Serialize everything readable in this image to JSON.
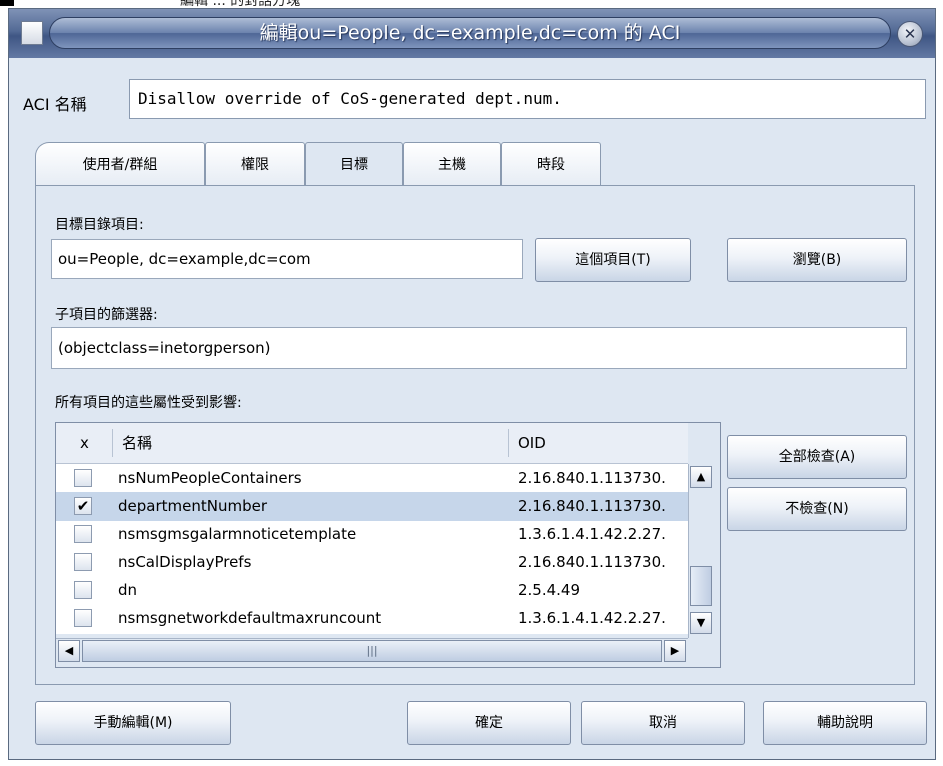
{
  "caption": {
    "text": "編輯 ... 的對話方塊"
  },
  "window": {
    "title": "編輯ou=People, dc=example,dc=com 的 ACI",
    "icon": "document-icon",
    "close_icon": "close-icon"
  },
  "aci": {
    "label": "ACI 名稱",
    "value": "Disallow override of CoS-generated dept.num."
  },
  "tabs": [
    {
      "label": "使用者/群組",
      "active": false
    },
    {
      "label": "權限",
      "active": false
    },
    {
      "label": "目標",
      "active": true
    },
    {
      "label": "主機",
      "active": false
    },
    {
      "label": "時段",
      "active": false
    }
  ],
  "target": {
    "dir_label": "目標目錄項目:",
    "dir_value": "ou=People, dc=example,dc=com",
    "this_entry_button": "這個項目(T)",
    "browse_button": "瀏覽(B)",
    "filter_label": "子項目的篩選器:",
    "filter_value": "(objectclass=inetorgperson)",
    "attrs_label": "所有項目的這些屬性受到影響:"
  },
  "table": {
    "columns": [
      "x",
      "名稱",
      "OID"
    ],
    "rows": [
      {
        "checked": false,
        "name": "nsNumPeopleContainers",
        "oid": "2.16.840.1.113730.",
        "selected": false
      },
      {
        "checked": true,
        "name": "departmentNumber",
        "oid": "2.16.840.1.113730.",
        "selected": true
      },
      {
        "checked": false,
        "name": "nsmsgmsgalarmnoticetemplate",
        "oid": "1.3.6.1.4.1.42.2.27.",
        "selected": false
      },
      {
        "checked": false,
        "name": "nsCalDisplayPrefs",
        "oid": "2.16.840.1.113730.",
        "selected": false
      },
      {
        "checked": false,
        "name": "dn",
        "oid": "2.5.4.49",
        "selected": false
      },
      {
        "checked": false,
        "name": "nsmsgnetworkdefaultmaxruncount",
        "oid": "1.3.6.1.4.1.42.2.27.",
        "selected": false
      }
    ],
    "check_mark": "✔"
  },
  "side_buttons": {
    "check_all": "全部檢查(A)",
    "uncheck": "不檢查(N)"
  },
  "footer": {
    "manual_edit": "手動編輯(M)",
    "ok": "確定",
    "cancel": "取消",
    "help": "輔助說明"
  },
  "colors": {
    "window_bg": "#dee7f2",
    "title_bar": "#536a95",
    "selected_row": "#c6d6ea"
  }
}
